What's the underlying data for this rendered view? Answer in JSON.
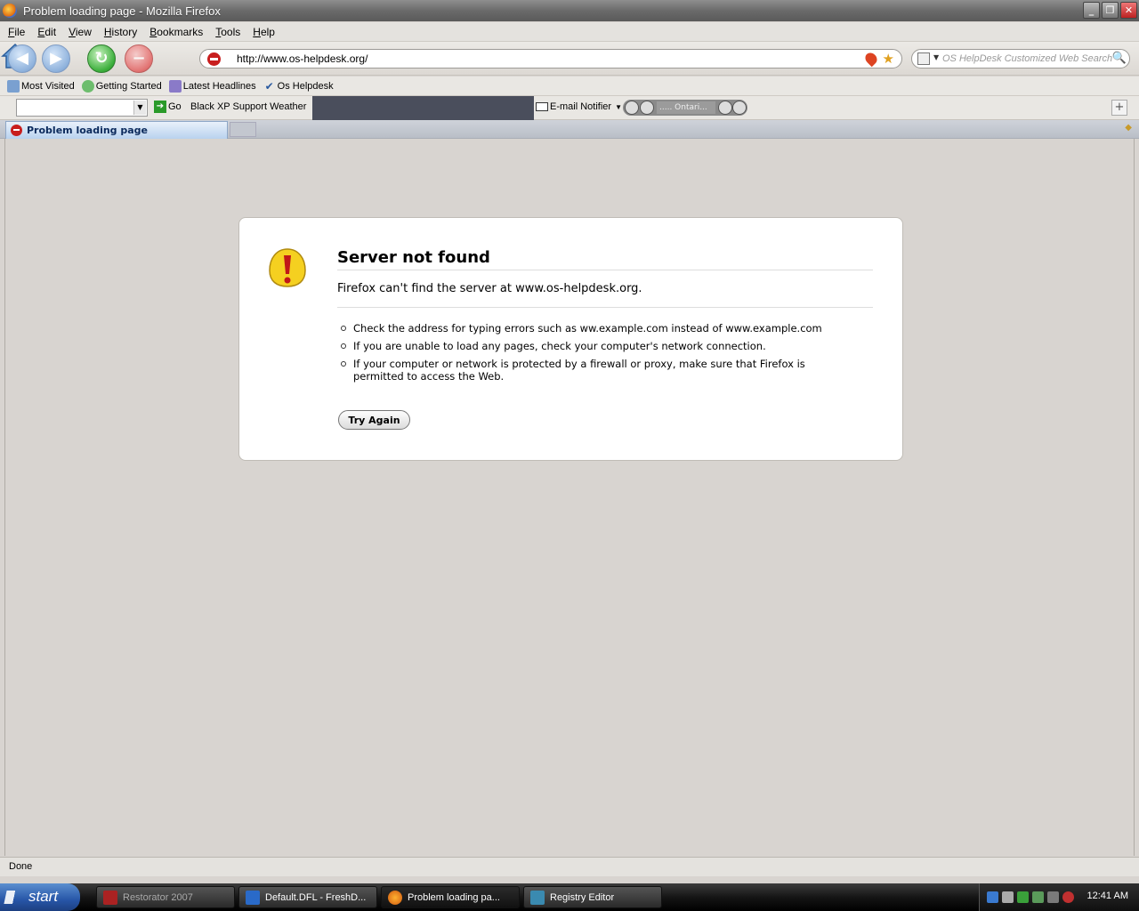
{
  "window": {
    "title": "Problem loading page - Mozilla Firefox"
  },
  "menu": [
    "File",
    "Edit",
    "View",
    "History",
    "Bookmarks",
    "Tools",
    "Help"
  ],
  "nav": {
    "url": "http://www.os-helpdesk.org/",
    "search_placeholder": "OS HelpDesk Customized Web Search"
  },
  "bookmarks": [
    "Most Visited",
    "Getting Started",
    "Latest Headlines",
    "Os Helpdesk"
  ],
  "toolbar2": {
    "go_label": "Go",
    "black_label": "Black XP Support Weather",
    "mail_label": "E-mail Notifier",
    "station_label": "..... Ontari..."
  },
  "tab": {
    "label": "Problem loading page"
  },
  "error": {
    "title": "Server not found",
    "lead": "Firefox can't find the server at www.os-helpdesk.org.",
    "items": [
      "Check the address for typing errors such as ww.example.com instead of www.example.com",
      "If you are unable to load any pages, check your computer's network connection.",
      "If your computer or network is protected by a firewall or proxy, make sure that Firefox is permitted to access the Web."
    ],
    "button": "Try Again"
  },
  "status": {
    "text": "Done"
  },
  "taskbar": {
    "start": "start",
    "tasks": [
      "Restorator 2007",
      "Default.DFL - FreshD...",
      "Problem loading pa...",
      "Registry Editor"
    ],
    "clock": "12:41 AM"
  }
}
